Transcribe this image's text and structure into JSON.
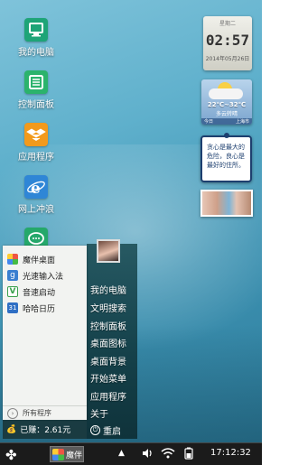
{
  "desktop_icons": [
    {
      "label": "我的电脑",
      "icon": "computer-icon"
    },
    {
      "label": "控制面板",
      "icon": "control-panel-icon"
    },
    {
      "label": "应用程序",
      "icon": "dropbox-icon"
    },
    {
      "label": "网上冲浪",
      "icon": "ie-browser-icon"
    },
    {
      "label": "",
      "icon": "chat-icon"
    }
  ],
  "widgets": {
    "clock": {
      "day": "星期二",
      "time": "02:57",
      "date": "2014年05月26日"
    },
    "weather": {
      "temp": "22℃~32℃",
      "condition": "多云转晴",
      "left": "今日",
      "right": "上海市"
    },
    "note": {
      "text": "贪心是最大的危险，良心是最好的住所。"
    }
  },
  "start_menu": {
    "items": [
      {
        "label": "魔伴桌面",
        "icon": "mobanzhuomian-icon",
        "color": "#e86b3a"
      },
      {
        "label": "光速输入法",
        "icon": "keyboard-icon",
        "color": "#3a7fd0"
      },
      {
        "label": "音速启动",
        "icon": "launcher-icon",
        "color": "#3aa14d"
      },
      {
        "label": "哈哈日历",
        "icon": "calendar-icon",
        "color": "#2f6fc4"
      }
    ],
    "all_programs": "所有程序",
    "earned": "已赚：2.61元",
    "right_items": [
      "我的电脑",
      "文明搜索",
      "控制面板",
      "桌面图标",
      "桌面背景",
      "开始菜单",
      "应用程序",
      "关于"
    ],
    "restart": "重启"
  },
  "taskbar": {
    "app_label": "魔伴",
    "time": "17:12:32"
  }
}
